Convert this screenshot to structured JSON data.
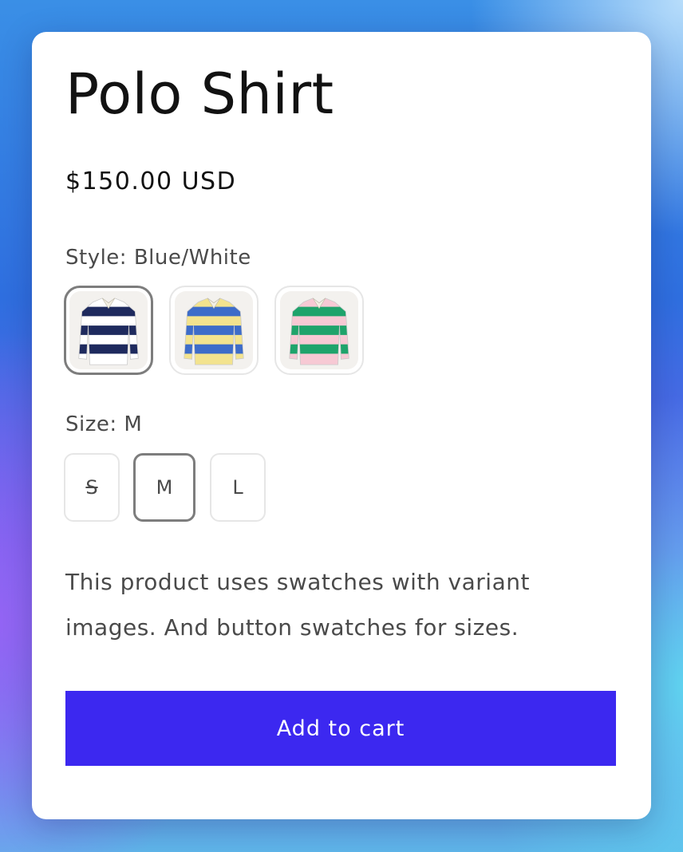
{
  "product": {
    "title": "Polo Shirt",
    "price": "$150.00 USD",
    "description": "This product uses swatches with variant images. And button swatches for sizes."
  },
  "style_option": {
    "label": "Style: Blue/White",
    "swatches": [
      {
        "name": "Blue/White",
        "colors": {
          "stripe_a": "#1e2a5e",
          "stripe_b": "#ffffff"
        },
        "selected": true
      },
      {
        "name": "Blue/Yellow",
        "colors": {
          "stripe_a": "#3d6cc9",
          "stripe_b": "#f3e38e"
        },
        "selected": false
      },
      {
        "name": "Green/Pink",
        "colors": {
          "stripe_a": "#1fa36b",
          "stripe_b": "#f7c9d4"
        },
        "selected": false
      }
    ]
  },
  "size_option": {
    "label": "Size: M",
    "sizes": [
      {
        "label": "S",
        "available": false,
        "selected": false
      },
      {
        "label": "M",
        "available": true,
        "selected": true
      },
      {
        "label": "L",
        "available": true,
        "selected": false
      }
    ]
  },
  "actions": {
    "add_to_cart": "Add to cart"
  },
  "colors": {
    "accent": "#3c28f0",
    "card": "#ffffff",
    "text_primary": "#121212",
    "text_secondary": "#4a4a4a"
  }
}
